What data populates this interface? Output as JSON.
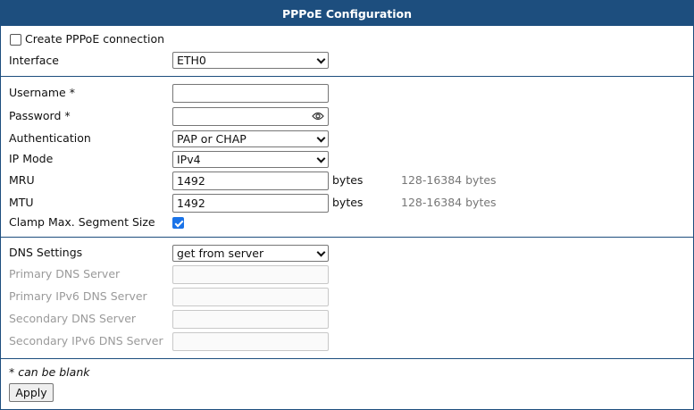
{
  "title": "PPPoE Configuration",
  "create_connection": {
    "label": "Create PPPoE connection",
    "checked": false
  },
  "interface": {
    "label": "Interface",
    "value": "ETH0"
  },
  "username": {
    "label": "Username *",
    "value": ""
  },
  "password": {
    "label": "Password *",
    "value": "",
    "icon": "eye-icon"
  },
  "authentication": {
    "label": "Authentication",
    "value": "PAP or CHAP"
  },
  "ip_mode": {
    "label": "IP Mode",
    "value": "IPv4"
  },
  "mru": {
    "label": "MRU",
    "value": "1492",
    "unit": "bytes",
    "hint": "128-16384 bytes"
  },
  "mtu": {
    "label": "MTU",
    "value": "1492",
    "unit": "bytes",
    "hint": "128-16384 bytes"
  },
  "clamp": {
    "label": "Clamp Max. Segment Size",
    "checked": true
  },
  "dns_settings": {
    "label": "DNS Settings",
    "value": "get from server"
  },
  "primary_dns": {
    "label": "Primary DNS Server",
    "value": ""
  },
  "primary_ipv6_dns": {
    "label": "Primary IPv6 DNS Server",
    "value": ""
  },
  "secondary_dns": {
    "label": "Secondary DNS Server",
    "value": ""
  },
  "secondary_ipv6_dns": {
    "label": "Secondary IPv6 DNS Server",
    "value": ""
  },
  "note": "* can be blank",
  "apply_label": "Apply",
  "colors": {
    "header": "#1d4e7e",
    "checkbox_checked": "#1a73e8",
    "disabled_text": "#9a9a9a",
    "hint_text": "#777777"
  }
}
